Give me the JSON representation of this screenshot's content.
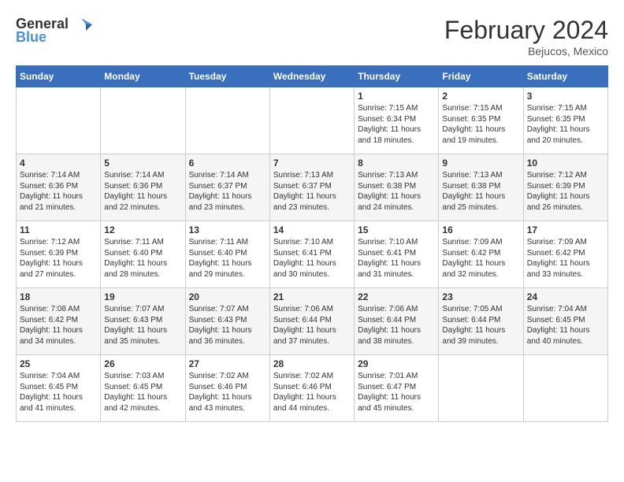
{
  "header": {
    "logo_line1": "General",
    "logo_line2": "Blue",
    "month_title": "February 2024",
    "location": "Bejucos, Mexico"
  },
  "weekdays": [
    "Sunday",
    "Monday",
    "Tuesday",
    "Wednesday",
    "Thursday",
    "Friday",
    "Saturday"
  ],
  "weeks": [
    [
      {
        "day": "",
        "empty": true
      },
      {
        "day": "",
        "empty": true
      },
      {
        "day": "",
        "empty": true
      },
      {
        "day": "",
        "empty": true
      },
      {
        "day": "1",
        "sunrise": "7:15 AM",
        "sunset": "6:34 PM",
        "daylight": "11 hours and 18 minutes."
      },
      {
        "day": "2",
        "sunrise": "7:15 AM",
        "sunset": "6:35 PM",
        "daylight": "11 hours and 19 minutes."
      },
      {
        "day": "3",
        "sunrise": "7:15 AM",
        "sunset": "6:35 PM",
        "daylight": "11 hours and 20 minutes."
      }
    ],
    [
      {
        "day": "4",
        "sunrise": "7:14 AM",
        "sunset": "6:36 PM",
        "daylight": "11 hours and 21 minutes."
      },
      {
        "day": "5",
        "sunrise": "7:14 AM",
        "sunset": "6:36 PM",
        "daylight": "11 hours and 22 minutes."
      },
      {
        "day": "6",
        "sunrise": "7:14 AM",
        "sunset": "6:37 PM",
        "daylight": "11 hours and 23 minutes."
      },
      {
        "day": "7",
        "sunrise": "7:13 AM",
        "sunset": "6:37 PM",
        "daylight": "11 hours and 23 minutes."
      },
      {
        "day": "8",
        "sunrise": "7:13 AM",
        "sunset": "6:38 PM",
        "daylight": "11 hours and 24 minutes."
      },
      {
        "day": "9",
        "sunrise": "7:13 AM",
        "sunset": "6:38 PM",
        "daylight": "11 hours and 25 minutes."
      },
      {
        "day": "10",
        "sunrise": "7:12 AM",
        "sunset": "6:39 PM",
        "daylight": "11 hours and 26 minutes."
      }
    ],
    [
      {
        "day": "11",
        "sunrise": "7:12 AM",
        "sunset": "6:39 PM",
        "daylight": "11 hours and 27 minutes."
      },
      {
        "day": "12",
        "sunrise": "7:11 AM",
        "sunset": "6:40 PM",
        "daylight": "11 hours and 28 minutes."
      },
      {
        "day": "13",
        "sunrise": "7:11 AM",
        "sunset": "6:40 PM",
        "daylight": "11 hours and 29 minutes."
      },
      {
        "day": "14",
        "sunrise": "7:10 AM",
        "sunset": "6:41 PM",
        "daylight": "11 hours and 30 minutes."
      },
      {
        "day": "15",
        "sunrise": "7:10 AM",
        "sunset": "6:41 PM",
        "daylight": "11 hours and 31 minutes."
      },
      {
        "day": "16",
        "sunrise": "7:09 AM",
        "sunset": "6:42 PM",
        "daylight": "11 hours and 32 minutes."
      },
      {
        "day": "17",
        "sunrise": "7:09 AM",
        "sunset": "6:42 PM",
        "daylight": "11 hours and 33 minutes."
      }
    ],
    [
      {
        "day": "18",
        "sunrise": "7:08 AM",
        "sunset": "6:42 PM",
        "daylight": "11 hours and 34 minutes."
      },
      {
        "day": "19",
        "sunrise": "7:07 AM",
        "sunset": "6:43 PM",
        "daylight": "11 hours and 35 minutes."
      },
      {
        "day": "20",
        "sunrise": "7:07 AM",
        "sunset": "6:43 PM",
        "daylight": "11 hours and 36 minutes."
      },
      {
        "day": "21",
        "sunrise": "7:06 AM",
        "sunset": "6:44 PM",
        "daylight": "11 hours and 37 minutes."
      },
      {
        "day": "22",
        "sunrise": "7:06 AM",
        "sunset": "6:44 PM",
        "daylight": "11 hours and 38 minutes."
      },
      {
        "day": "23",
        "sunrise": "7:05 AM",
        "sunset": "6:44 PM",
        "daylight": "11 hours and 39 minutes."
      },
      {
        "day": "24",
        "sunrise": "7:04 AM",
        "sunset": "6:45 PM",
        "daylight": "11 hours and 40 minutes."
      }
    ],
    [
      {
        "day": "25",
        "sunrise": "7:04 AM",
        "sunset": "6:45 PM",
        "daylight": "11 hours and 41 minutes."
      },
      {
        "day": "26",
        "sunrise": "7:03 AM",
        "sunset": "6:45 PM",
        "daylight": "11 hours and 42 minutes."
      },
      {
        "day": "27",
        "sunrise": "7:02 AM",
        "sunset": "6:46 PM",
        "daylight": "11 hours and 43 minutes."
      },
      {
        "day": "28",
        "sunrise": "7:02 AM",
        "sunset": "6:46 PM",
        "daylight": "11 hours and 44 minutes."
      },
      {
        "day": "29",
        "sunrise": "7:01 AM",
        "sunset": "6:47 PM",
        "daylight": "11 hours and 45 minutes."
      },
      {
        "day": "",
        "empty": true
      },
      {
        "day": "",
        "empty": true
      }
    ]
  ],
  "labels": {
    "sunrise": "Sunrise:",
    "sunset": "Sunset:",
    "daylight": "Daylight:"
  }
}
